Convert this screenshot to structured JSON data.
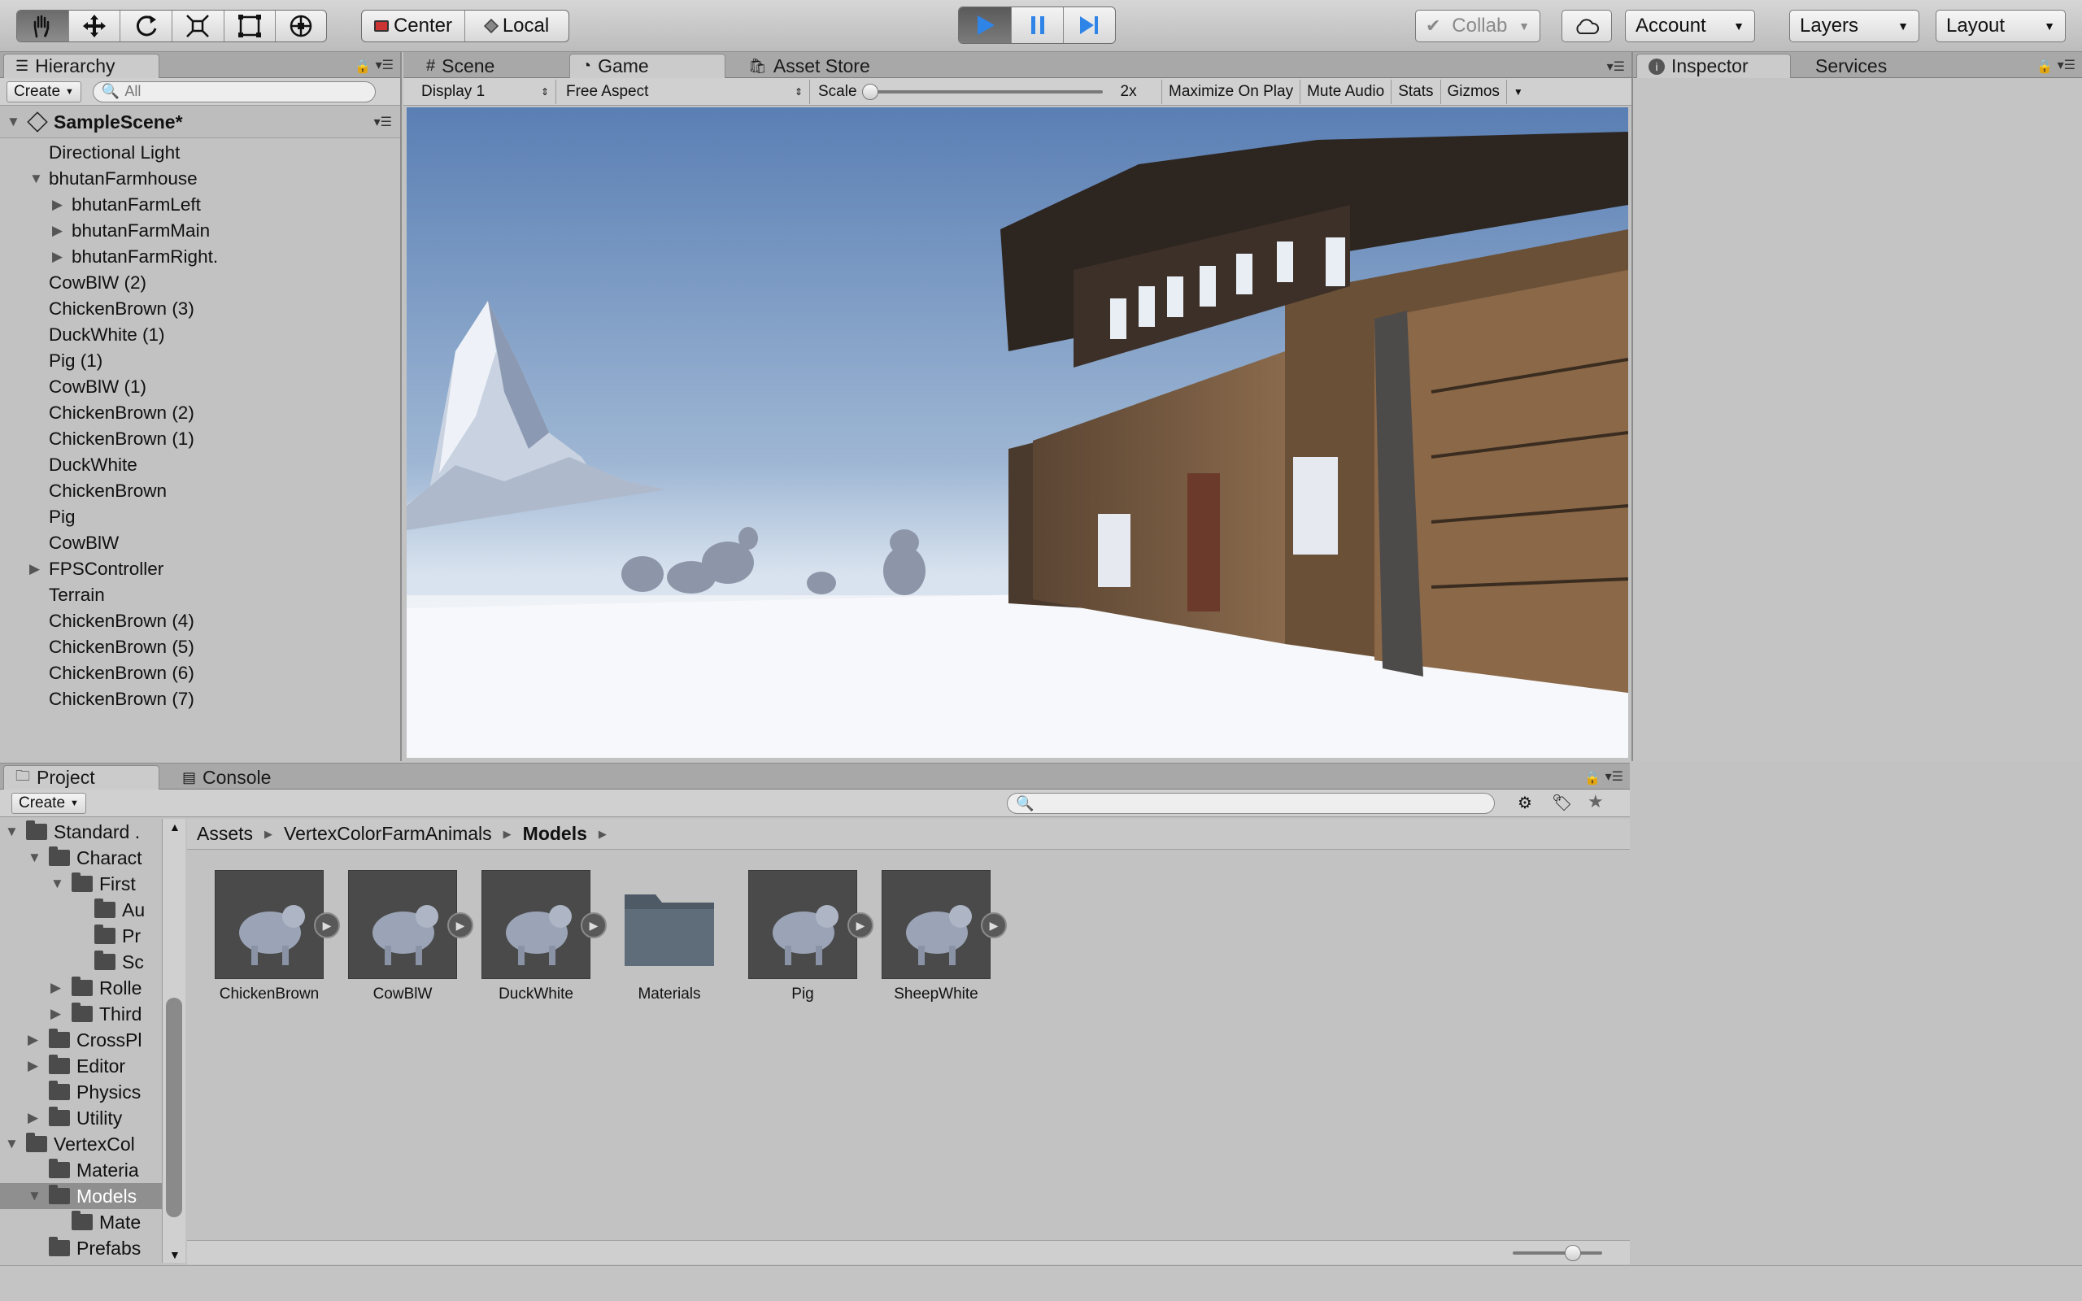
{
  "toolbar": {
    "tools": [
      "hand-tool",
      "move-tool",
      "rotate-tool",
      "scale-tool",
      "rect-tool",
      "transform-tool"
    ],
    "pivot": {
      "center": "Center",
      "local": "Local"
    },
    "collab": "Collab",
    "account": "Account",
    "layers": "Layers",
    "layout": "Layout"
  },
  "hierarchy": {
    "tab": "Hierarchy",
    "create": "Create",
    "search_placeholder": "All",
    "scene": "SampleScene*",
    "items": [
      {
        "label": "Directional Light"
      },
      {
        "label": "bhutanFarmhouse"
      },
      {
        "label": "bhutanFarmLeft"
      },
      {
        "label": "bhutanFarmMain"
      },
      {
        "label": "bhutanFarmRight."
      },
      {
        "label": "CowBlW (2)"
      },
      {
        "label": "ChickenBrown (3)"
      },
      {
        "label": "DuckWhite (1)"
      },
      {
        "label": "Pig (1)"
      },
      {
        "label": "CowBlW (1)"
      },
      {
        "label": "ChickenBrown (2)"
      },
      {
        "label": "ChickenBrown (1)"
      },
      {
        "label": "DuckWhite"
      },
      {
        "label": "ChickenBrown"
      },
      {
        "label": "Pig"
      },
      {
        "label": "CowBlW"
      },
      {
        "label": "FPSController"
      },
      {
        "label": "Terrain"
      },
      {
        "label": "ChickenBrown (4)"
      },
      {
        "label": "ChickenBrown (5)"
      },
      {
        "label": "ChickenBrown (6)"
      },
      {
        "label": "ChickenBrown (7)"
      }
    ]
  },
  "center_tabs": {
    "scene": "Scene",
    "game": "Game",
    "asset_store": "Asset Store"
  },
  "game_bar": {
    "display": "Display 1",
    "aspect": "Free Aspect",
    "scale_label": "Scale",
    "scale_value": "2x",
    "maximize": "Maximize On Play",
    "mute": "Mute Audio",
    "stats": "Stats",
    "gizmos": "Gizmos"
  },
  "inspector": {
    "tab": "Inspector",
    "services": "Services"
  },
  "project": {
    "tab": "Project",
    "console": "Console",
    "create": "Create",
    "tree": [
      {
        "label": "Standard ."
      },
      {
        "label": "Charact"
      },
      {
        "label": "First"
      },
      {
        "label": "Au"
      },
      {
        "label": "Pr"
      },
      {
        "label": "Sc"
      },
      {
        "label": "Rolle"
      },
      {
        "label": "Third"
      },
      {
        "label": "CrossPl"
      },
      {
        "label": "Editor"
      },
      {
        "label": "Physics"
      },
      {
        "label": "Utility"
      },
      {
        "label": "VertexCol"
      },
      {
        "label": "Materia"
      },
      {
        "label": "Models"
      },
      {
        "label": "Mate"
      },
      {
        "label": "Prefabs"
      }
    ],
    "breadcrumb": [
      "Assets",
      "VertexColorFarmAnimals",
      "Models"
    ],
    "assets": [
      {
        "label": "ChickenBrown"
      },
      {
        "label": "CowBlW"
      },
      {
        "label": "DuckWhite"
      },
      {
        "label": "Materials"
      },
      {
        "label": "Pig"
      },
      {
        "label": "SheepWhite"
      }
    ]
  }
}
